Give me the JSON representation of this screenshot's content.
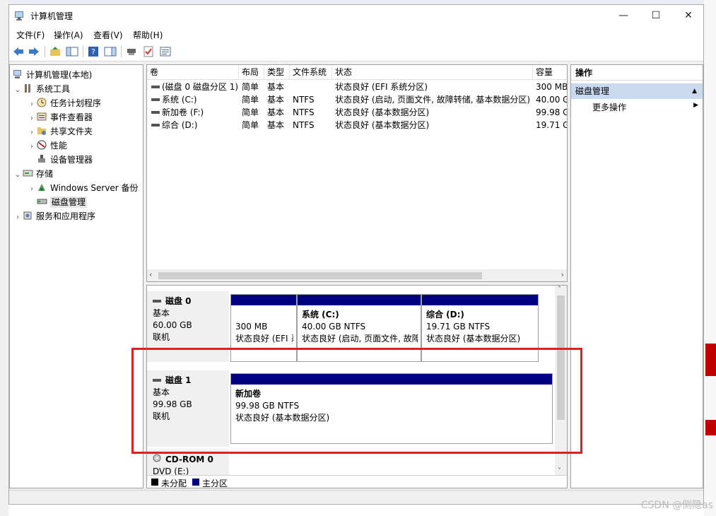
{
  "window": {
    "title": "计算机管理",
    "controls": {
      "minimize": "—",
      "maximize": "☐",
      "close": "✕"
    }
  },
  "menu": [
    "文件(F)",
    "操作(A)",
    "查看(V)",
    "帮助(H)"
  ],
  "tree": {
    "items": [
      {
        "label": "计算机管理(本地)",
        "level": 0,
        "expander": "",
        "icon": "computer-icon"
      },
      {
        "label": "系统工具",
        "level": 1,
        "expander": "⌄",
        "icon": "tools-icon"
      },
      {
        "label": "任务计划程序",
        "level": 2,
        "expander": "›",
        "icon": "clock-icon"
      },
      {
        "label": "事件查看器",
        "level": 2,
        "expander": "›",
        "icon": "event-viewer-icon"
      },
      {
        "label": "共享文件夹",
        "level": 2,
        "expander": "›",
        "icon": "shared-folder-icon"
      },
      {
        "label": "性能",
        "level": 2,
        "expander": "›",
        "icon": "performance-icon"
      },
      {
        "label": "设备管理器",
        "level": 2,
        "expander": "",
        "icon": "device-manager-icon"
      },
      {
        "label": "存储",
        "level": 1,
        "expander": "⌄",
        "icon": "storage-icon"
      },
      {
        "label": "Windows Server 备份",
        "level": 2,
        "expander": "›",
        "icon": "backup-icon"
      },
      {
        "label": "磁盘管理",
        "level": 2,
        "expander": "",
        "icon": "disk-management-icon",
        "selected": true
      },
      {
        "label": "服务和应用程序",
        "level": 1,
        "expander": "›",
        "icon": "services-icon"
      }
    ]
  },
  "volume_list": {
    "columns": [
      "卷",
      "布局",
      "类型",
      "文件系统",
      "状态",
      "容量"
    ],
    "rows": [
      [
        "(磁盘 0 磁盘分区 1)",
        "简单",
        "基本",
        "",
        "状态良好 (EFI 系统分区)",
        "300 MB"
      ],
      [
        "系统 (C:)",
        "简单",
        "基本",
        "NTFS",
        "状态良好 (启动, 页面文件, 故障转储, 基本数据分区)",
        "40.00 GB"
      ],
      [
        "新加卷 (F:)",
        "简单",
        "基本",
        "NTFS",
        "状态良好 (基本数据分区)",
        "99.98 GB"
      ],
      [
        "综合 (D:)",
        "简单",
        "基本",
        "NTFS",
        "状态良好 (基本数据分区)",
        "19.71 GB"
      ]
    ]
  },
  "disks": [
    {
      "name": "磁盘 0",
      "type": "基本",
      "size": "60.00 GB",
      "state": "联机",
      "partitions": [
        {
          "name": "",
          "size": "300 MB",
          "status": "状态良好 (EFI 系统分区)"
        },
        {
          "name": "系统 (C:)",
          "size": "40.00 GB NTFS",
          "status": "状态良好 (启动, 页面文件, 故障转储, 基本数据分区)"
        },
        {
          "name": "综合 (D:)",
          "size": "19.71 GB NTFS",
          "status": "状态良好 (基本数据分区)"
        }
      ]
    },
    {
      "name": "磁盘 1",
      "type": "基本",
      "size": "99.98 GB",
      "state": "联机",
      "partitions": [
        {
          "name": "新加卷",
          "size": "99.98 GB NTFS",
          "status": "状态良好 (基本数据分区)"
        }
      ]
    },
    {
      "name": "CD-ROM 0",
      "type": "DVD (E:)"
    }
  ],
  "legend": [
    {
      "label": "未分配",
      "color": "#000000"
    },
    {
      "label": "主分区",
      "color": "#000080"
    }
  ],
  "actions": {
    "header": "操作",
    "group": "磁盘管理",
    "items": [
      "更多操作"
    ]
  },
  "watermark": "CSDN @侧隐as",
  "colors": {
    "partition_bar": "#000080",
    "highlight_box": "#e02020",
    "selected_action_group": "#c9daf0"
  }
}
